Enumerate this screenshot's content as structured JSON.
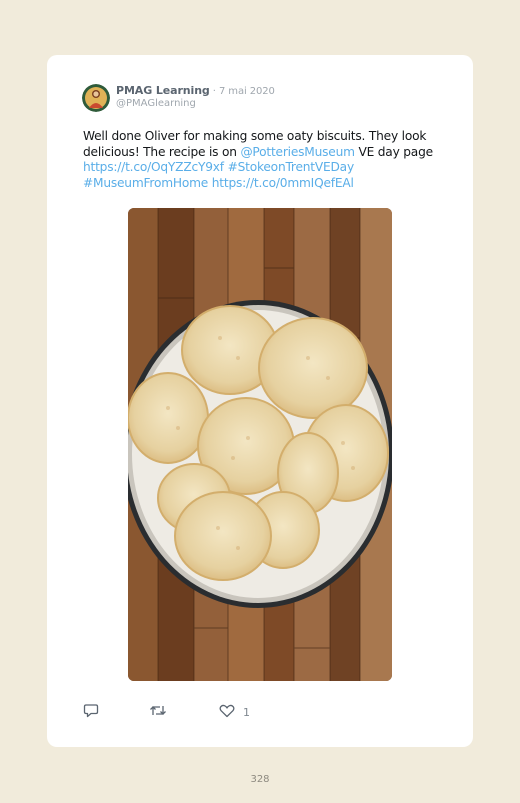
{
  "tweet": {
    "author_name": "PMAG Learning",
    "separator": " · ",
    "date": "7 mai 2020",
    "handle": "@PMAGlearning",
    "text_1": "Well done Oliver for making some oaty biscuits. They look delicious! The recipe is on ",
    "mention": "@PotteriesMuseum",
    "text_2": " VE day page ",
    "link_1": "https://t.co/OqYZZcY9xf",
    "hashtag_1": "#StokeonTrentVEDay",
    "hashtag_2": "#MuseumFromHome",
    "link_2": "https://t.co/0mmIQefEAl",
    "like_count": "1"
  },
  "page_number": "328",
  "colors": {
    "background": "#f1ebdb",
    "card": "#ffffff",
    "link": "#5aaee8",
    "text": "#14171a"
  },
  "icons": [
    "reply-icon",
    "retweet-icon",
    "heart-icon"
  ]
}
